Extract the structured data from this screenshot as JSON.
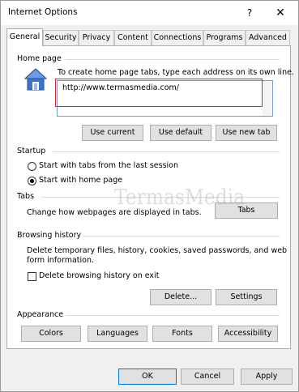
{
  "window": {
    "title": "Internet Options",
    "help_label": "?",
    "close_label": "✕"
  },
  "tabs": [
    {
      "label": "General"
    },
    {
      "label": "Security"
    },
    {
      "label": "Privacy"
    },
    {
      "label": "Content"
    },
    {
      "label": "Connections"
    },
    {
      "label": "Programs"
    },
    {
      "label": "Advanced"
    }
  ],
  "home_page": {
    "group_title": "Home page",
    "instruction": "To create home page tabs, type each address on its own line.",
    "url": "http://www.termasmedia.com/",
    "use_current": "Use current",
    "use_default": "Use default",
    "use_new_tab": "Use new tab"
  },
  "startup": {
    "group_title": "Startup",
    "option_last_session": "Start with tabs from the last session",
    "option_home_page": "Start with home page",
    "selected": "home_page"
  },
  "tabs_group": {
    "group_title": "Tabs",
    "description": "Change how webpages are displayed in tabs.",
    "button": "Tabs"
  },
  "browsing_history": {
    "group_title": "Browsing history",
    "description_line1": "Delete temporary files, history, cookies, saved passwords, and web",
    "description_line2": "form information.",
    "delete_on_exit": "Delete browsing history on exit",
    "delete_on_exit_checked": false,
    "delete_button": "Delete...",
    "settings_button": "Settings"
  },
  "appearance": {
    "group_title": "Appearance",
    "colors": "Colors",
    "languages": "Languages",
    "fonts": "Fonts",
    "accessibility": "Accessibility"
  },
  "footer": {
    "ok": "OK",
    "cancel": "Cancel",
    "apply": "Apply"
  },
  "watermark": "TermasMedia"
}
